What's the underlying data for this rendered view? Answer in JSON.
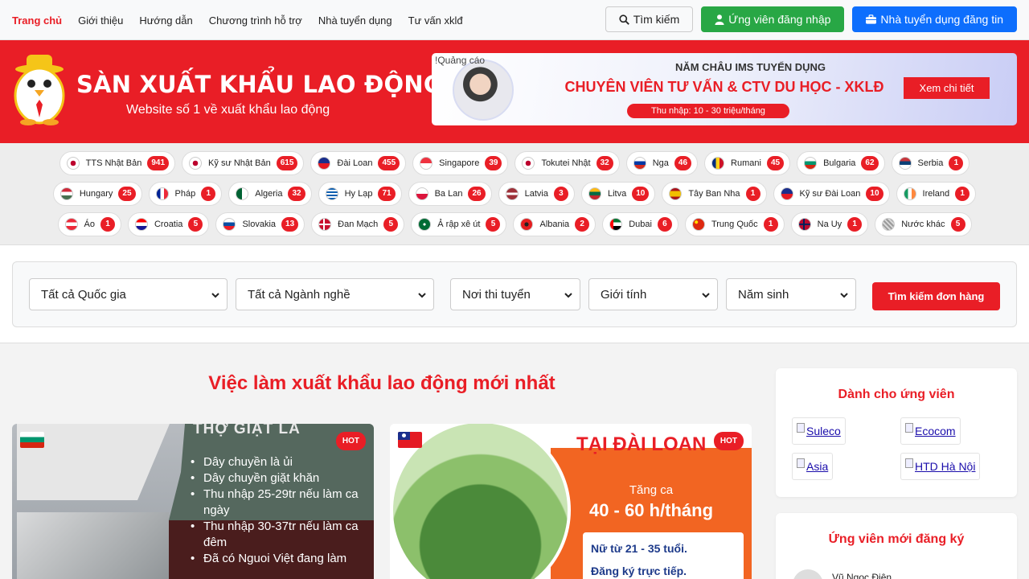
{
  "nav": {
    "links": [
      "Trang chủ",
      "Giới thiệu",
      "Hướng dẫn",
      "Chương trình hỗ trợ",
      "Nhà tuyển dụng",
      "Tư vấn xklđ"
    ],
    "search_label": "Tìm kiếm",
    "candidate_login_label": "Ứng viên đăng nhập",
    "employer_post_label": "Nhà tuyển dụng đăng tin"
  },
  "header": {
    "site_name": "SÀN XUẤT KHẨU LAO ĐỘNG .COM",
    "tagline": "Website số 1 về xuất khẩu lao động",
    "ad": {
      "label": "!Quảng cáo",
      "title": "NĂM CHÂU IMS TUYỂN DỤNG",
      "headline": "CHUYÊN VIÊN TƯ VẤN & CTV DU HỌC - XKLĐ",
      "salary": "Thu nhập: 10 - 30 triệu/tháng",
      "cta": "Xem chi tiết"
    }
  },
  "countries": [
    [
      {
        "name": "TTS Nhật Bản",
        "count": "941",
        "flag": "jp"
      },
      {
        "name": "Kỹ sư Nhật Bản",
        "count": "615",
        "flag": "jp"
      },
      {
        "name": "Đài Loan",
        "count": "455",
        "flag": "tw"
      },
      {
        "name": "Singapore",
        "count": "39",
        "flag": "sg"
      },
      {
        "name": "Tokutei Nhật",
        "count": "32",
        "flag": "jp"
      },
      {
        "name": "Nga",
        "count": "46",
        "flag": "ru"
      },
      {
        "name": "Rumani",
        "count": "45",
        "flag": "ro"
      },
      {
        "name": "Bulgaria",
        "count": "62",
        "flag": "bg"
      },
      {
        "name": "Serbia",
        "count": "1",
        "flag": "rs"
      }
    ],
    [
      {
        "name": "Hungary",
        "count": "25",
        "flag": "hu"
      },
      {
        "name": "Pháp",
        "count": "1",
        "flag": "fr"
      },
      {
        "name": "Algeria",
        "count": "32",
        "flag": "dz"
      },
      {
        "name": "Hy Lạp",
        "count": "71",
        "flag": "gr"
      },
      {
        "name": "Ba Lan",
        "count": "26",
        "flag": "pl"
      },
      {
        "name": "Latvia",
        "count": "3",
        "flag": "lv"
      },
      {
        "name": "Litva",
        "count": "10",
        "flag": "lt"
      },
      {
        "name": "Tây Ban Nha",
        "count": "1",
        "flag": "es"
      },
      {
        "name": "Kỹ sư Đài Loan",
        "count": "10",
        "flag": "tw"
      },
      {
        "name": "Ireland",
        "count": "1",
        "flag": "ie"
      }
    ],
    [
      {
        "name": "Áo",
        "count": "1",
        "flag": "at"
      },
      {
        "name": "Croatia",
        "count": "5",
        "flag": "hr"
      },
      {
        "name": "Slovakia",
        "count": "13",
        "flag": "sk"
      },
      {
        "name": "Đan Mạch",
        "count": "5",
        "flag": "dk"
      },
      {
        "name": "Ả rập xê út",
        "count": "5",
        "flag": "sa"
      },
      {
        "name": "Albania",
        "count": "2",
        "flag": "al"
      },
      {
        "name": "Dubai",
        "count": "6",
        "flag": "ae"
      },
      {
        "name": "Trung Quốc",
        "count": "1",
        "flag": "cn"
      },
      {
        "name": "Na Uy",
        "count": "1",
        "flag": "no"
      },
      {
        "name": "Nước khác",
        "count": "5",
        "flag": "other"
      }
    ]
  ],
  "filter": {
    "country": "Tất cả Quốc gia",
    "industry": "Tất cả Ngành nghề",
    "exam_location": "Nơi thi tuyển",
    "gender": "Giới tính",
    "birth_year": "Năm sinh",
    "submit_label": "Tìm kiếm đơn hàng"
  },
  "main": {
    "section_title": "Việc làm xuất khẩu lao động mới nhất",
    "hot_label": "HOT",
    "cards": [
      {
        "flag": "bg",
        "title": "THỢ GIẶT LÀ",
        "lines": [
          "Dây chuyền là ủi",
          "Dây chuyền giặt khăn",
          "Thu nhập 25-29tr nếu làm ca ngày",
          "Thu nhập 30-37tr nếu làm ca đêm",
          "Đã có Nguoi Việt đang làm"
        ]
      },
      {
        "flag": "tw",
        "title": "TẠI ĐÀI LOAN",
        "overtime": "Tăng ca",
        "hours": "40 - 60 h/tháng",
        "bullets": [
          "Nữ từ 21 - 35 tuổi.",
          "Đăng ký trực tiếp."
        ]
      }
    ]
  },
  "sidebar": {
    "candidates_title": "Dành cho ứng viên",
    "partners": [
      "Suleco",
      "Ecocom",
      "Asia",
      "HTD Hà Nội"
    ],
    "new_candidates_title": "Ứng viên mới đăng ký",
    "new_candidate_name": "Vũ Ngọc Điện"
  },
  "colors": {
    "brand_red": "#e91e26",
    "green": "#28a745",
    "blue": "#0d6efd"
  },
  "icons": {
    "search": "search-icon",
    "user": "user-icon",
    "briefcase": "briefcase-icon"
  }
}
